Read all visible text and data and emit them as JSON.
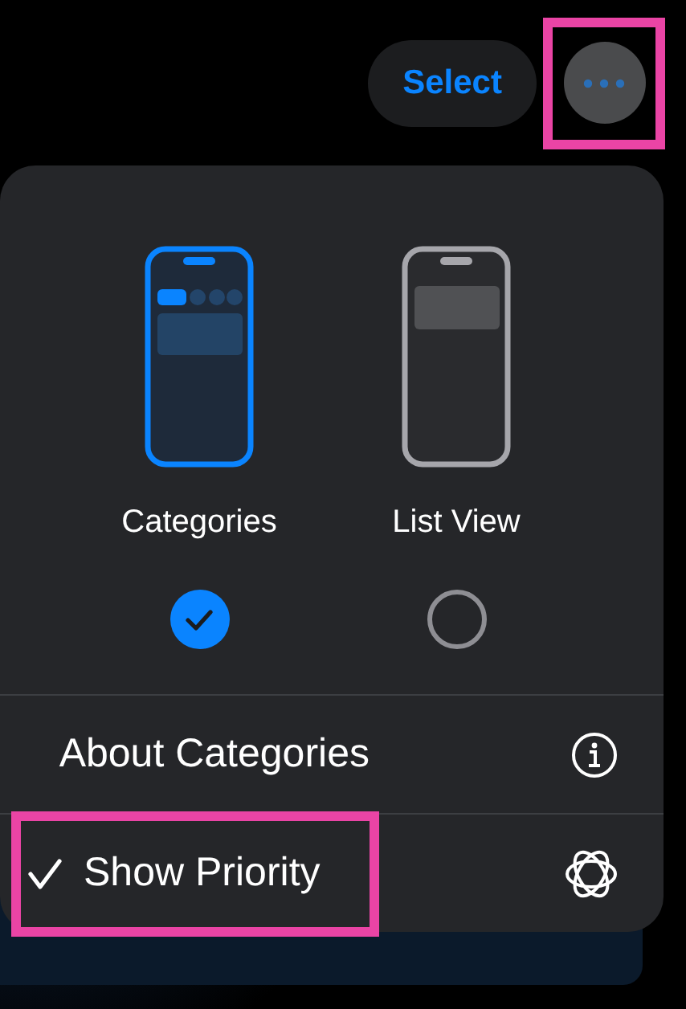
{
  "nav": {
    "select_label": "Select"
  },
  "view_options": [
    {
      "kind": "categories",
      "label": "Categories",
      "selected": true
    },
    {
      "kind": "list",
      "label": "List View",
      "selected": false
    }
  ],
  "menu_items": [
    {
      "kind": "info",
      "label": "About Categories",
      "checked": false,
      "highlighted": false
    },
    {
      "kind": "priority",
      "label": "Show Priority",
      "checked": true,
      "highlighted": true
    }
  ],
  "more_button_highlighted": true
}
